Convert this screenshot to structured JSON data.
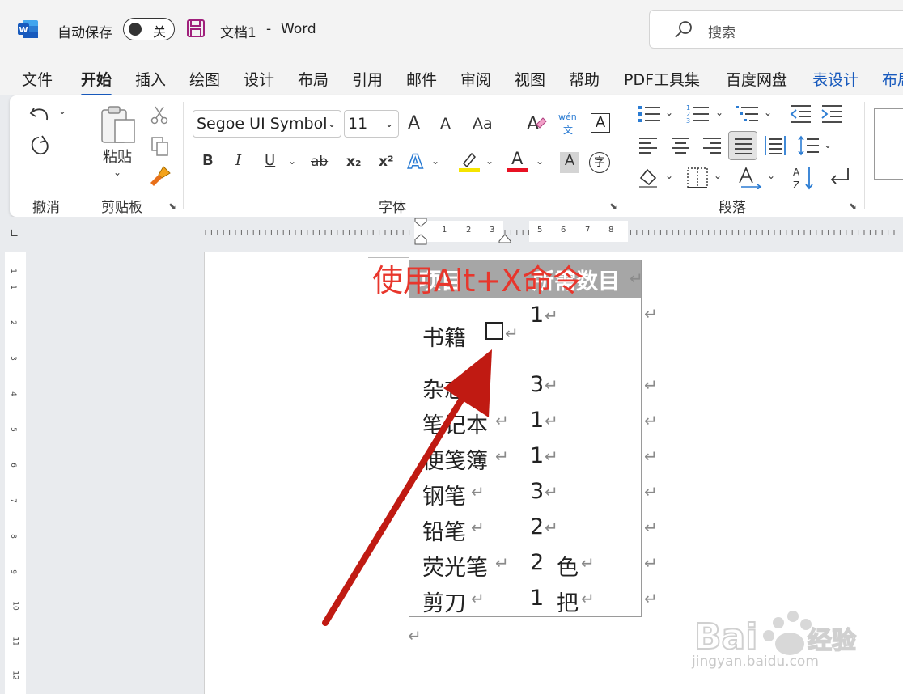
{
  "titlebar": {
    "autosave_label": "自动保存",
    "autosave_state": "关",
    "doc_name": "文档1",
    "separator": "-",
    "app_name": "Word",
    "search_placeholder": "搜索"
  },
  "tabs": [
    "文件",
    "开始",
    "插入",
    "绘图",
    "设计",
    "布局",
    "引用",
    "邮件",
    "审阅",
    "视图",
    "帮助",
    "PDF工具集",
    "百度网盘",
    "表设计",
    "布局"
  ],
  "active_tab": "开始",
  "ribbon": {
    "groups": {
      "undo": "撤消",
      "clipboard": "剪贴板",
      "font": "字体",
      "paragraph": "段落"
    },
    "paste_label": "粘贴",
    "font_name": "Segoe UI Symbol",
    "font_size": "11",
    "font_grow": "A",
    "font_shrink": "A",
    "change_case": "Aa",
    "phonetic_top": "wén",
    "phonetic_bottom": "文",
    "bold": "B",
    "italic": "I",
    "underline": "U",
    "strike": "ab",
    "subscript": "x₂",
    "superscript": "x²",
    "char_shading": "A",
    "enclose": "字",
    "colors": {
      "highlight": "#f5e400",
      "font_color": "#e81123",
      "accent": "#185abd"
    }
  },
  "ruler": {
    "h_numbers": [
      "1",
      "2",
      "3",
      "5",
      "6",
      "7",
      "8"
    ],
    "v_numbers": [
      "1",
      "1",
      "2",
      "3",
      "4",
      "5",
      "6",
      "7",
      "8",
      "9",
      "10",
      "11",
      "12"
    ]
  },
  "document": {
    "header": {
      "col1": "项目",
      "col2": "所需数目"
    },
    "rows": [
      {
        "item": "书籍",
        "qty": "1",
        "unit": ""
      },
      {
        "item": "杂志",
        "qty": "3",
        "unit": ""
      },
      {
        "item": "笔记本",
        "qty": "1",
        "unit": ""
      },
      {
        "item": "便笺簿",
        "qty": "1",
        "unit": ""
      },
      {
        "item": "钢笔",
        "qty": "3",
        "unit": ""
      },
      {
        "item": "铅笔",
        "qty": "2",
        "unit": ""
      },
      {
        "item": "荧光笔",
        "qty": "2",
        "unit": "色"
      },
      {
        "item": "剪刀",
        "qty": "1",
        "unit": "把"
      }
    ],
    "paragraph_mark": "↵"
  },
  "annotation": "使用Alt+X命令",
  "watermark": "jingyan.baidu.com"
}
